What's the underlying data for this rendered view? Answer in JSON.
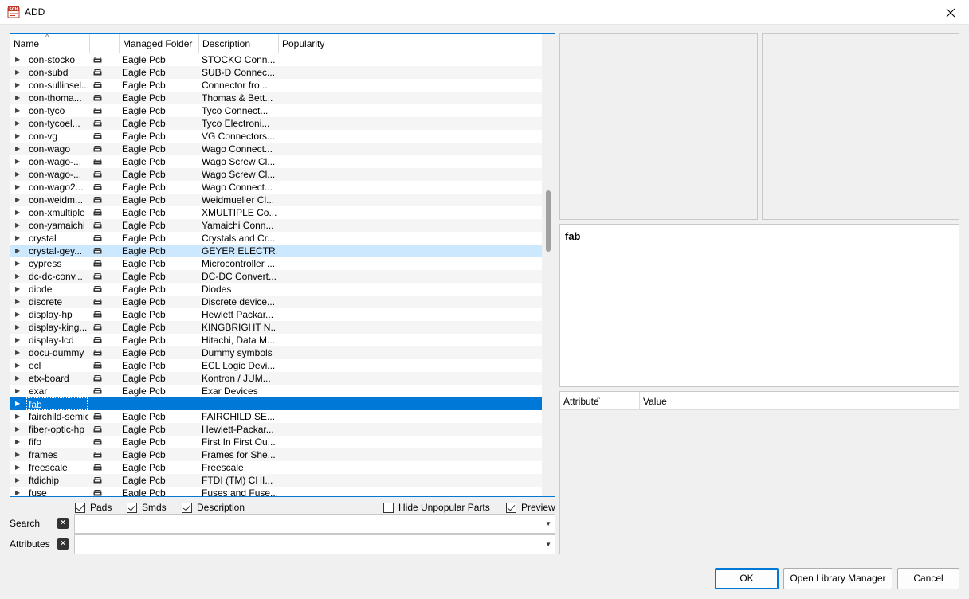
{
  "window": {
    "title": "ADD",
    "icon": "sch-app-icon",
    "close_icon": "close-icon"
  },
  "tree": {
    "headers": {
      "name": "Name",
      "folder": "Managed Folder",
      "description": "Description",
      "popularity": "Popularity"
    },
    "rows": [
      {
        "name": "con-stocko",
        "folder": "Eagle Pcb",
        "desc": "STOCKO Conn..."
      },
      {
        "name": "con-subd",
        "folder": "Eagle Pcb",
        "desc": "SUB-D Connec..."
      },
      {
        "name": "con-sullinsel...",
        "folder": "Eagle Pcb",
        "desc": "Connector fro..."
      },
      {
        "name": "con-thoma...",
        "folder": "Eagle Pcb",
        "desc": "Thomas & Bett..."
      },
      {
        "name": "con-tyco",
        "folder": "Eagle Pcb",
        "desc": "Tyco Connect..."
      },
      {
        "name": "con-tycoel...",
        "folder": "Eagle Pcb",
        "desc": "Tyco Electroni..."
      },
      {
        "name": "con-vg",
        "folder": "Eagle Pcb",
        "desc": "VG Connectors..."
      },
      {
        "name": "con-wago",
        "folder": "Eagle Pcb",
        "desc": "Wago Connect..."
      },
      {
        "name": "con-wago-...",
        "folder": "Eagle Pcb",
        "desc": "Wago Screw Cl..."
      },
      {
        "name": "con-wago-...",
        "folder": "Eagle Pcb",
        "desc": "Wago Screw Cl..."
      },
      {
        "name": "con-wago2...",
        "folder": "Eagle Pcb",
        "desc": "Wago Connect..."
      },
      {
        "name": "con-weidm...",
        "folder": "Eagle Pcb",
        "desc": "Weidmueller Cl..."
      },
      {
        "name": "con-xmultiple",
        "folder": "Eagle Pcb",
        "desc": "XMULTIPLE Co..."
      },
      {
        "name": "con-yamaichi",
        "folder": "Eagle Pcb",
        "desc": "Yamaichi Conn..."
      },
      {
        "name": "crystal",
        "folder": "Eagle Pcb",
        "desc": "Crystals and Cr..."
      },
      {
        "name": "crystal-gey...",
        "folder": "Eagle Pcb",
        "desc": "GEYER ELECTR...",
        "state": "hover"
      },
      {
        "name": "cypress",
        "folder": "Eagle Pcb",
        "desc": "Microcontroller ..."
      },
      {
        "name": "dc-dc-conv...",
        "folder": "Eagle Pcb",
        "desc": "DC-DC Convert..."
      },
      {
        "name": "diode",
        "folder": "Eagle Pcb",
        "desc": "Diodes"
      },
      {
        "name": "discrete",
        "folder": "Eagle Pcb",
        "desc": "Discrete device..."
      },
      {
        "name": "display-hp",
        "folder": "Eagle Pcb",
        "desc": "Hewlett Packar..."
      },
      {
        "name": "display-king...",
        "folder": "Eagle Pcb",
        "desc": "KINGBRIGHT N..."
      },
      {
        "name": "display-lcd",
        "folder": "Eagle Pcb",
        "desc": "Hitachi, Data M..."
      },
      {
        "name": "docu-dummy",
        "folder": "Eagle Pcb",
        "desc": "Dummy symbols"
      },
      {
        "name": "ecl",
        "folder": "Eagle Pcb",
        "desc": "ECL Logic Devi..."
      },
      {
        "name": "etx-board",
        "folder": "Eagle Pcb",
        "desc": "Kontron / JUM..."
      },
      {
        "name": "exar",
        "folder": "Eagle Pcb",
        "desc": "Exar Devices"
      },
      {
        "name": "fab",
        "folder": "",
        "desc": "",
        "state": "selected",
        "no_icon": true
      },
      {
        "name": "fairchild-semic",
        "folder": "Eagle Pcb",
        "desc": "FAIRCHILD SE..."
      },
      {
        "name": "fiber-optic-hp",
        "folder": "Eagle Pcb",
        "desc": "Hewlett-Packar..."
      },
      {
        "name": "fifo",
        "folder": "Eagle Pcb",
        "desc": "First In First Ou..."
      },
      {
        "name": "frames",
        "folder": "Eagle Pcb",
        "desc": "Frames for She..."
      },
      {
        "name": "freescale",
        "folder": "Eagle Pcb",
        "desc": "Freescale"
      },
      {
        "name": "ftdichip",
        "folder": "Eagle Pcb",
        "desc": "FTDI (TM) CHI..."
      },
      {
        "name": "fuse",
        "folder": "Eagle Pcb",
        "desc": "Fuses and Fuse..."
      }
    ]
  },
  "options": {
    "pads": {
      "label": "Pads",
      "checked": true
    },
    "smds": {
      "label": "Smds",
      "checked": true
    },
    "description": {
      "label": "Description",
      "checked": true
    },
    "hide_unpopular": {
      "label": "Hide Unpopular Parts",
      "checked": false
    },
    "preview": {
      "label": "Preview",
      "checked": true
    }
  },
  "search": {
    "label": "Search",
    "value": ""
  },
  "attributes": {
    "label": "Attributes",
    "value": ""
  },
  "info": {
    "title": "fab"
  },
  "attr_table": {
    "col_attribute": "Attribute",
    "col_value": "Value"
  },
  "buttons": {
    "ok": "OK",
    "open_library_manager": "Open Library Manager",
    "cancel": "Cancel"
  }
}
